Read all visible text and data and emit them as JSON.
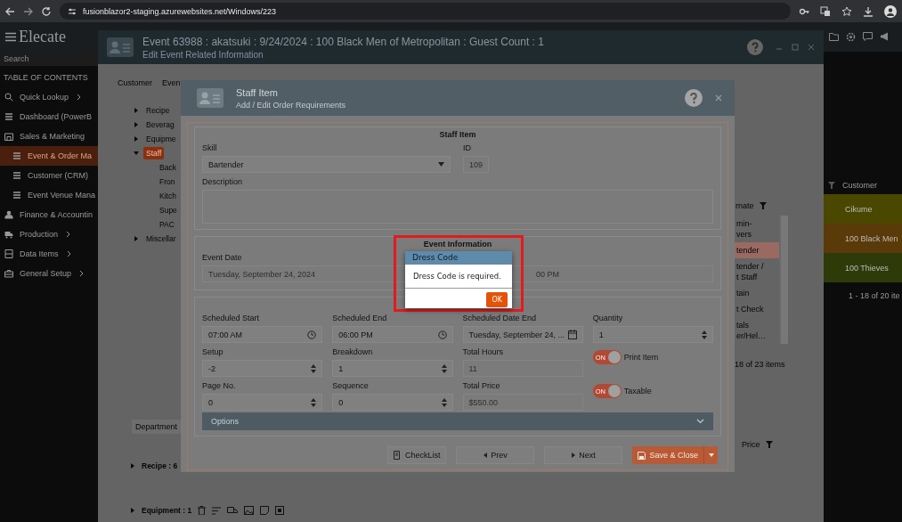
{
  "browser": {
    "url": "fusionblazor2-staging.azurewebsites.net/Windows/223"
  },
  "app": {
    "logo": "Elecate",
    "search_placeholder": "Search",
    "toc_title": "TABLE OF CONTENTS",
    "menu": [
      {
        "label": "Quick Lookup",
        "expandable": true,
        "selected": false
      },
      {
        "label": "Dashboard (PowerB",
        "expandable": false,
        "selected": false
      },
      {
        "label": "Sales & Marketing",
        "expandable": false,
        "selected": false,
        "children": [
          {
            "label": "Event & Order Ma",
            "selected": true
          },
          {
            "label": "Customer (CRM)",
            "selected": false
          },
          {
            "label": "Event Venue Mana",
            "selected": false
          }
        ]
      },
      {
        "label": "Finance & Accountin",
        "expandable": false,
        "selected": false
      },
      {
        "label": "Production",
        "expandable": true,
        "selected": false
      },
      {
        "label": "Data Items",
        "expandable": true,
        "selected": false
      },
      {
        "label": "General Setup",
        "expandable": true,
        "selected": false
      }
    ]
  },
  "background_grid": {
    "header": "Customer",
    "rows": [
      {
        "text": "Cikume",
        "color": "#4a4700"
      },
      {
        "text": "100 Black Men",
        "color": "#5a3a08"
      },
      {
        "text": "100 Thieves",
        "color": "#2e3a08"
      }
    ],
    "pager": "1 - 18 of 20 ite"
  },
  "event_window": {
    "title": "Event 63988 : akatsuki : 9/24/2024 : 100 Black Men of Metropolitan : Guest Count : 1",
    "subtitle": "Edit Event Related Information",
    "tabs": [
      {
        "label": "Customer",
        "selected": false
      },
      {
        "label": "Even",
        "selected": false
      }
    ],
    "tree": [
      {
        "label": "Recipe",
        "expanded": false,
        "selected": false
      },
      {
        "label": "Beverag",
        "expanded": false,
        "selected": false
      },
      {
        "label": "Equipme",
        "expanded": false,
        "selected": false
      },
      {
        "label": "Staff",
        "expanded": true,
        "selected": true,
        "children": [
          {
            "label": "Back"
          },
          {
            "label": "Fron"
          },
          {
            "label": "Kitch"
          },
          {
            "label": "Supe"
          },
          {
            "label": "PAC"
          }
        ]
      },
      {
        "label": "Miscellar",
        "expanded": false,
        "selected": false
      }
    ],
    "grid": {
      "header": "rnate",
      "rows": [
        {
          "lines": [
            "min-",
            "vers"
          ],
          "selected": false
        },
        {
          "lines": [
            "tender"
          ],
          "selected": true
        },
        {
          "lines": [
            "tender /",
            "t Staff"
          ],
          "selected": false
        },
        {
          "lines": [
            "tain"
          ],
          "selected": false
        },
        {
          "lines": [
            "t Check"
          ],
          "selected": false
        },
        {
          "lines": [
            "tals",
            "er/Hel…"
          ],
          "selected": false
        }
      ],
      "pager": "18 of 23 items"
    },
    "department": "Department",
    "price_header": "Price",
    "groups": [
      "Recipe : 6",
      "Equipment : 1"
    ]
  },
  "staff_dialog": {
    "title": "Staff Item",
    "subtitle": "Add / Edit Order Requirements",
    "section": "Staff Item",
    "skill_label": "Skill",
    "skill_value": "Bartender",
    "id_label": "ID",
    "id_value": "109",
    "description_label": "Description",
    "event_info_title": "Event Information",
    "event_date_label": "Event Date",
    "event_date_value": "Tuesday, September 24, 2024",
    "event_time_value": "00 PM",
    "fields": [
      {
        "kind": "time",
        "label": "Scheduled Start",
        "value": "07:00 AM"
      },
      {
        "kind": "time",
        "label": "Scheduled End",
        "value": "06:00 PM"
      },
      {
        "kind": "date",
        "label": "Scheduled Date End",
        "value": "Tuesday, September 24, ..."
      },
      {
        "kind": "spin",
        "label": "Quantity",
        "value": "1"
      },
      {
        "kind": "spin",
        "label": "Setup",
        "value": "-2"
      },
      {
        "kind": "spin",
        "label": "Breakdown",
        "value": "1"
      },
      {
        "kind": "readonly",
        "label": "Total Hours",
        "value": "11"
      },
      {
        "kind": "toggle",
        "label": "Print Item",
        "on": true,
        "state_text": "ON"
      },
      {
        "kind": "spin",
        "label": "Page No.",
        "value": "0"
      },
      {
        "kind": "spin",
        "label": "Sequence",
        "value": "0"
      },
      {
        "kind": "readonly",
        "label": "Total Price",
        "value": "$550.00"
      },
      {
        "kind": "toggle",
        "label": "Taxable",
        "on": true,
        "state_text": "ON"
      }
    ],
    "options": "Options",
    "buttons": [
      {
        "kind": "checklist",
        "label": "CheckList"
      },
      {
        "kind": "prev",
        "label": "Prev"
      },
      {
        "kind": "next",
        "label": "Next"
      },
      {
        "kind": "save",
        "label": "Save & Close"
      }
    ]
  },
  "alert": {
    "title": "Dress Code",
    "message": "Dress Code is required.",
    "button": "OK",
    "outlined": true
  }
}
